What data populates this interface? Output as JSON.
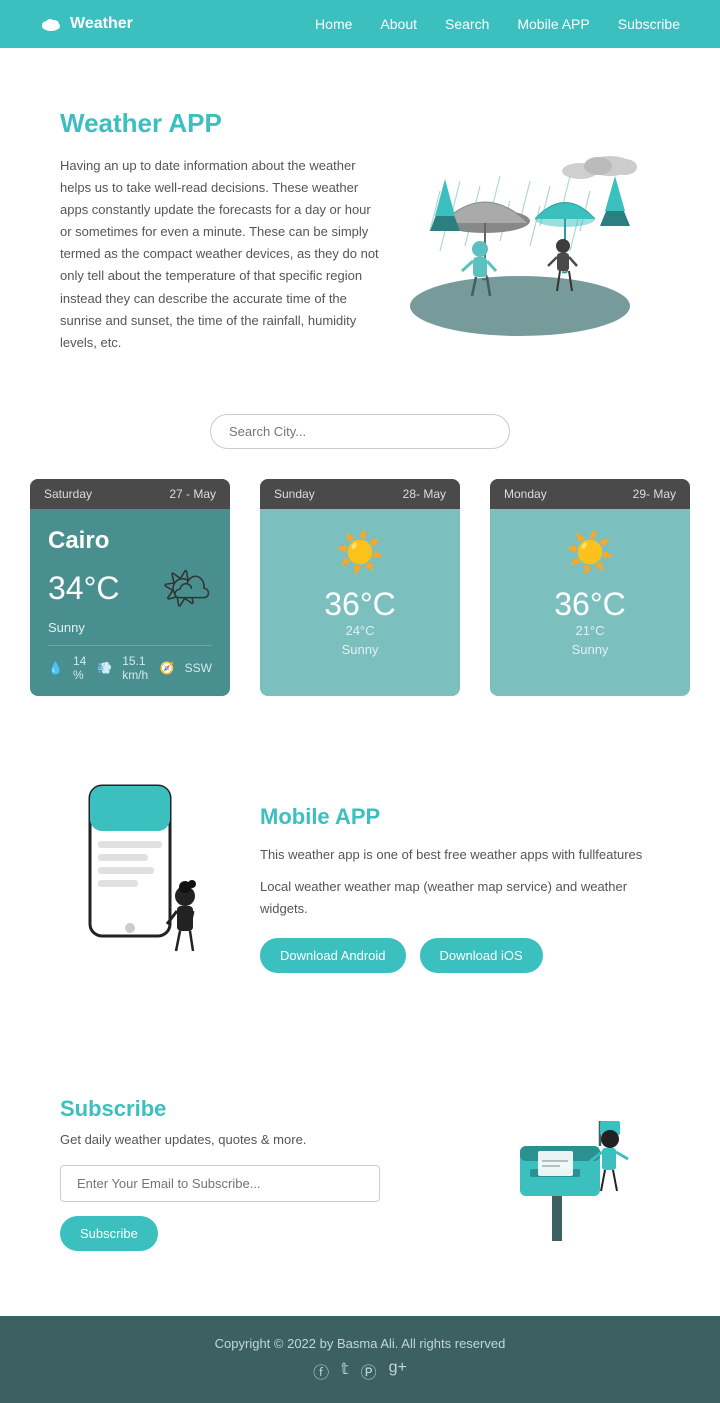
{
  "nav": {
    "brand": "Weather",
    "links": [
      "Home",
      "About",
      "Search",
      "Mobile APP",
      "Subscribe"
    ]
  },
  "hero": {
    "title": "Weather APP",
    "description": "Having an up to date information about the weather helps us to take well-read decisions. These weather apps constantly update the forecasts for a day or hour or sometimes for even a minute. These can be simply termed as the compact weather devices, as they do not only tell about the temperature of that specific region instead they can describe the accurate time of the sunrise and sunset, the time of the rainfall, humidity levels, etc."
  },
  "search": {
    "placeholder": "Search City..."
  },
  "weather_cards": [
    {
      "day": "Saturday",
      "date": "27 - May",
      "city": "Cairo",
      "temp": "34°C",
      "temp_secondary": "",
      "condition": "Sunny",
      "humidity": "14 %",
      "wind": "15.1 km/h",
      "direction": "SSW",
      "is_main": true
    },
    {
      "day": "Sunday",
      "date": "28- May",
      "city": "",
      "temp": "36°C",
      "temp_secondary": "24°C",
      "condition": "Sunny",
      "is_main": false
    },
    {
      "day": "Monday",
      "date": "29- May",
      "city": "",
      "temp": "36°C",
      "temp_secondary": "21°C",
      "condition": "Sunny",
      "is_main": false
    }
  ],
  "mobile": {
    "title": "Mobile APP",
    "line1": "This weather app is one of best free weather apps with fullfeatures",
    "line2": "Local weather weather map (weather map service) and weather widgets.",
    "btn_android": "Download Android",
    "btn_ios": "Download iOS"
  },
  "subscribe": {
    "title": "Subscribe",
    "description": "Get daily weather updates, quotes & more.",
    "input_placeholder": "Enter Your Email to Subscribe...",
    "button_label": "Subscribe"
  },
  "footer": {
    "copyright": "Copyright © 2022 by Basma Ali. All rights reserved",
    "social": [
      "f",
      "t",
      "p",
      "g+"
    ]
  }
}
